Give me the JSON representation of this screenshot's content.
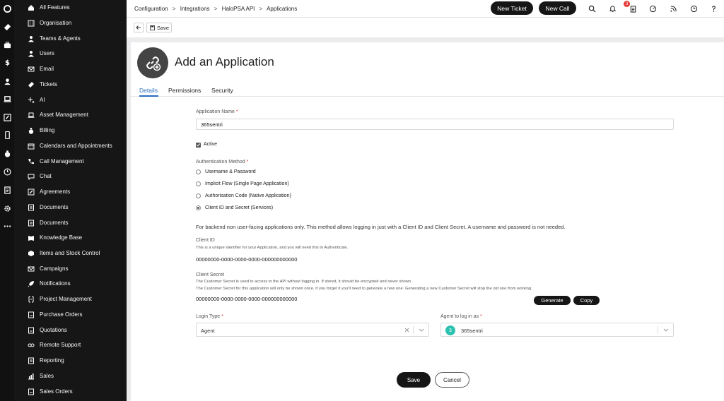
{
  "sidebar": {
    "items": [
      {
        "label": "All Features",
        "icon": "home-icon"
      },
      {
        "label": "Organisation",
        "icon": "building-icon"
      },
      {
        "label": "Teams & Agents",
        "icon": "user-icon"
      },
      {
        "label": "Users",
        "icon": "user-icon"
      },
      {
        "label": "Email",
        "icon": "email-icon"
      },
      {
        "label": "Tickets",
        "icon": "ticket-icon"
      },
      {
        "label": "AI",
        "icon": "sparkle-icon"
      },
      {
        "label": "Asset Management",
        "icon": "laptop-icon"
      },
      {
        "label": "Billing",
        "icon": "money-bag-icon"
      },
      {
        "label": "Calendars and Appointments",
        "icon": "calendar-icon"
      },
      {
        "label": "Call Management",
        "icon": "phone-icon"
      },
      {
        "label": "Chat",
        "icon": "chat-icon"
      },
      {
        "label": "Agreements",
        "icon": "agreement-icon"
      },
      {
        "label": "Documents",
        "icon": "document-icon"
      },
      {
        "label": "Documents",
        "icon": "document-icon"
      },
      {
        "label": "Knowledge Base",
        "icon": "book-icon"
      },
      {
        "label": "Items and Stock Control",
        "icon": "box-icon"
      },
      {
        "label": "Campaigns",
        "icon": "campaign-icon"
      },
      {
        "label": "Notifications",
        "icon": "rocket-icon"
      },
      {
        "label": "Project Management",
        "icon": "project-icon"
      },
      {
        "label": "Purchase Orders",
        "icon": "purchase-order-icon"
      },
      {
        "label": "Quotations",
        "icon": "quotation-icon"
      },
      {
        "label": "Remote Support",
        "icon": "remote-icon"
      },
      {
        "label": "Reporting",
        "icon": "report-icon"
      },
      {
        "label": "Sales",
        "icon": "chart-icon"
      },
      {
        "label": "Sales Orders",
        "icon": "sales-order-icon"
      }
    ]
  },
  "rail": {
    "icons": [
      "logo-icon",
      "ticket-icon",
      "briefcase-icon",
      "dollar-icon",
      "user-icon",
      "laptop-icon",
      "edit-icon",
      "mobile-icon",
      "money-bag-icon",
      "clock-icon",
      "document-icon",
      "settings-icon",
      "more-icon"
    ]
  },
  "header": {
    "breadcrumbs": [
      "Configuration",
      "Integrations",
      "HaloPSA API",
      "Applications"
    ],
    "separator": ">",
    "new_ticket_label": "New Ticket",
    "new_call_label": "New Call",
    "notification_count": "3"
  },
  "toolbar": {
    "save_label": "Save"
  },
  "page": {
    "title": "Add an Application",
    "tabs": [
      "Details",
      "Permissions",
      "Security"
    ],
    "active_tab": "Details"
  },
  "form": {
    "app_name_label": "Application Name",
    "required_mark": "*",
    "app_name_value": "365sentri",
    "active_label": "Active",
    "active_checked": true,
    "auth_method_label": "Authentication Method",
    "auth_options": [
      {
        "label": "Username & Password",
        "checked": false
      },
      {
        "label": "Implicit Flow (Single Page Application)",
        "checked": false
      },
      {
        "label": "Authorisation Code (Native Application)",
        "checked": false
      },
      {
        "label": "Client ID and Secret (Services)",
        "checked": true
      }
    ],
    "auth_info": "For backend non user-facing applications only. This method allows logging in just with a Client ID and Client Secret. A username and password is not needed.",
    "client_id_label": "Client ID",
    "client_id_help": "This is a unique identifier for your Application, and you will need this to Authenticate.",
    "client_id_value": "00000000-0000-0000-0000-000000000000",
    "client_secret_label": "Client Secret",
    "client_secret_help_1": "The Customer Secret is used to access to the API without logging in. If stored, it should be encrypted and never shown.",
    "client_secret_help_2": "The Customer Secret for this application will only be shown once. If you forget it you'll need to generate a new one. Generating a new Customer Secret will stop the old one from working.",
    "client_secret_value": "00000000-0000-0000-0000-000000000000",
    "generate_label": "Generate",
    "copy_label": "Copy",
    "login_type_label": "Login Type",
    "login_type_value": "Agent",
    "agent_label": "Agent to log in as",
    "agent_avatar": "3",
    "agent_value": "365sentri",
    "save_label": "Save",
    "cancel_label": "Cancel"
  },
  "colors": {
    "sidebar_bg": "#161616",
    "accent": "#2a6dbf",
    "avatar": "#2dc1b0",
    "badge": "#e53935"
  }
}
